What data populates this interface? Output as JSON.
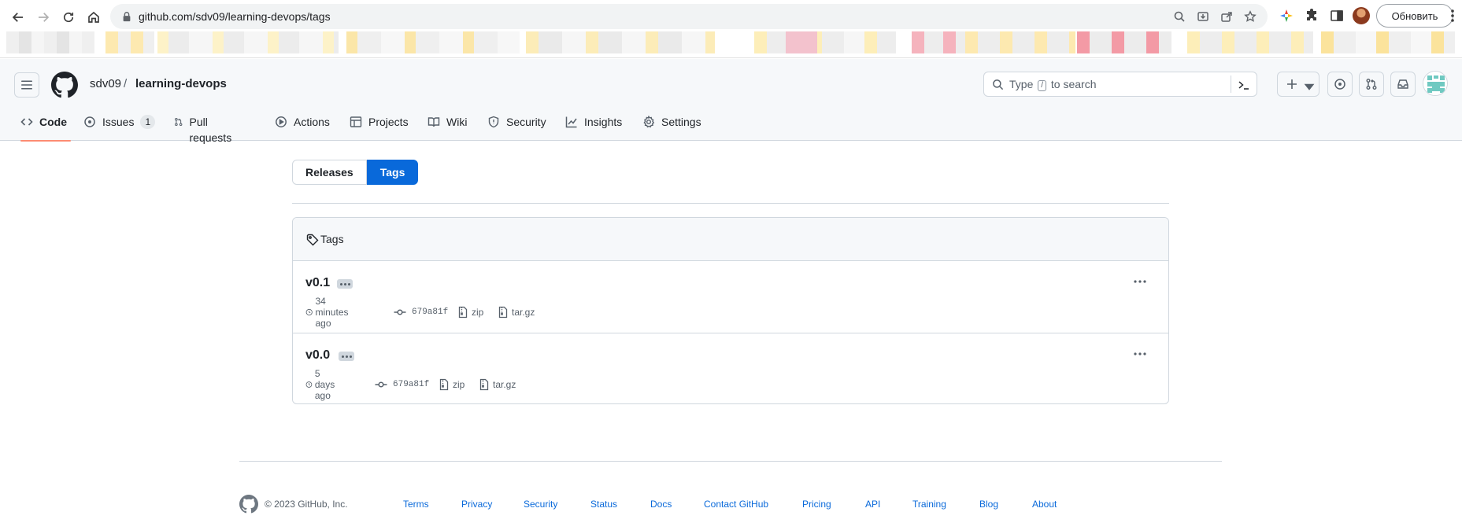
{
  "browser": {
    "url": "github.com/sdv09/learning-devops/tags",
    "update_button": "Обновить"
  },
  "header": {
    "owner": "sdv09",
    "separator": "/",
    "repo": "learning-devops",
    "search_placeholder_pre": "Type",
    "search_key": "/",
    "search_placeholder_post": "to search"
  },
  "tabs": [
    {
      "label": "Code",
      "icon": "code-icon",
      "active": true
    },
    {
      "label": "Issues",
      "icon": "issue-opened-icon",
      "counter": "1"
    },
    {
      "label": "Pull requests",
      "icon": "git-pull-request-icon"
    },
    {
      "label": "Actions",
      "icon": "play-icon"
    },
    {
      "label": "Projects",
      "icon": "table-icon"
    },
    {
      "label": "Wiki",
      "icon": "book-icon"
    },
    {
      "label": "Security",
      "icon": "shield-icon"
    },
    {
      "label": "Insights",
      "icon": "graph-icon"
    },
    {
      "label": "Settings",
      "icon": "gear-icon"
    }
  ],
  "subnav": {
    "releases": "Releases",
    "tags": "Tags"
  },
  "tags_box": {
    "title": "Tags",
    "items": [
      {
        "name": "v0.1",
        "time": "34 minutes ago",
        "commit": "679a81f",
        "zip": "zip",
        "targz": "tar.gz"
      },
      {
        "name": "v0.0",
        "time": "5 days ago",
        "commit": "679a81f",
        "zip": "zip",
        "targz": "tar.gz"
      }
    ]
  },
  "footer": {
    "copyright": "© 2023 GitHub, Inc.",
    "links": [
      "Terms",
      "Privacy",
      "Security",
      "Status",
      "Docs",
      "Contact GitHub",
      "Pricing",
      "API",
      "Training",
      "Blog",
      "About"
    ]
  },
  "colors": {
    "accent_blue": "#0969da",
    "tab_underline": "#fd8c73",
    "border": "#d0d7de"
  }
}
